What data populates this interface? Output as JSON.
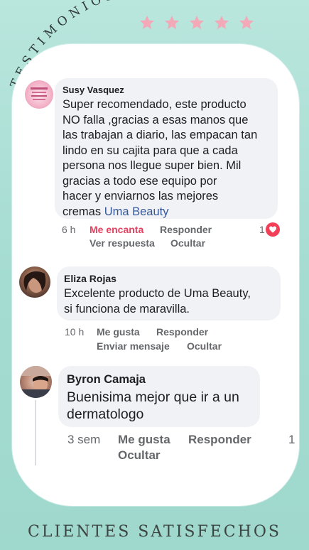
{
  "header": {
    "arc_left": "TESTIMONIOS",
    "stars_count": 5,
    "star_color": "#f3a9b7"
  },
  "comments": [
    {
      "author": "Susy Vasquez",
      "text_lines": [
        "Super recomendado, este producto",
        "NO falla ,gracias  a esas manos que",
        "las trabajan a diario, las empacan tan",
        "lindo en su cajita  para que a cada",
        "persona nos llegue super bien. Mil",
        "gracias  a todo ese equipo  por",
        "hacer y enviarnos las mejores"
      ],
      "last_line_prefix": "cremas ",
      "link_text": "Uma Beauty",
      "time": "6 h",
      "reaction": "Me encanta",
      "reply": "Responder",
      "see_reply": "Ver respuesta",
      "hide": "Ocultar",
      "reaction_count": "1"
    },
    {
      "author": "Eliza Rojas",
      "text_lines": [
        "Excelente producto de Uma Beauty,",
        "si funciona de maravilla."
      ],
      "time": "10 h",
      "like": "Me gusta",
      "reply": "Responder",
      "message": "Enviar mensaje",
      "hide": "Ocultar"
    },
    {
      "author": "Byron Camaja",
      "text_lines": [
        "Buenisima mejor que ir a un",
        "dermatologo"
      ],
      "time": "3 sem",
      "like": "Me gusta",
      "reply": "Responder",
      "hide": "Ocultar",
      "edge_count": "1"
    }
  ],
  "footer": {
    "title": "CLIENTES SATISFECHOS"
  },
  "colors": {
    "background": "#a7ded4",
    "card": "#ffffff",
    "bubble": "#f0f2f5",
    "link": "#385898",
    "love": "#e4405f",
    "meta": "#65676b"
  }
}
